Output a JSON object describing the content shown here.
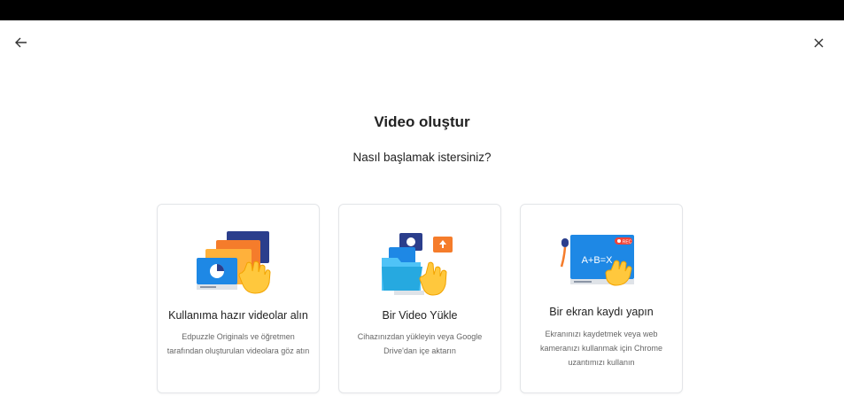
{
  "header": {
    "back_icon": "arrow-left-icon",
    "close_icon": "close-x-icon"
  },
  "main": {
    "title": "Video oluştur",
    "subtitle": "Nasıl başlamak istersiniz?"
  },
  "cards": [
    {
      "title": "Kullanıma hazır videolar alın",
      "desc": "Edpuzzle Originals ve öğretmen tarafından oluşturulan videolara göz atın"
    },
    {
      "title": "Bir Video Yükle",
      "desc": "Cihazınızdan yükleyin veya Google Drive'dan içe aktarın"
    },
    {
      "title": "Bir ekran kaydı yapın",
      "desc": "Ekranınızı kaydetmek veya web kameranızı kullanmak için Chrome uzantımızı kullanın",
      "illustration_text": "A+B=X",
      "rec_badge": "REC"
    }
  ],
  "colors": {
    "accent_blue": "#1e88e5",
    "accent_orange": "#f57c2b",
    "hand_yellow": "#ffc83d"
  }
}
